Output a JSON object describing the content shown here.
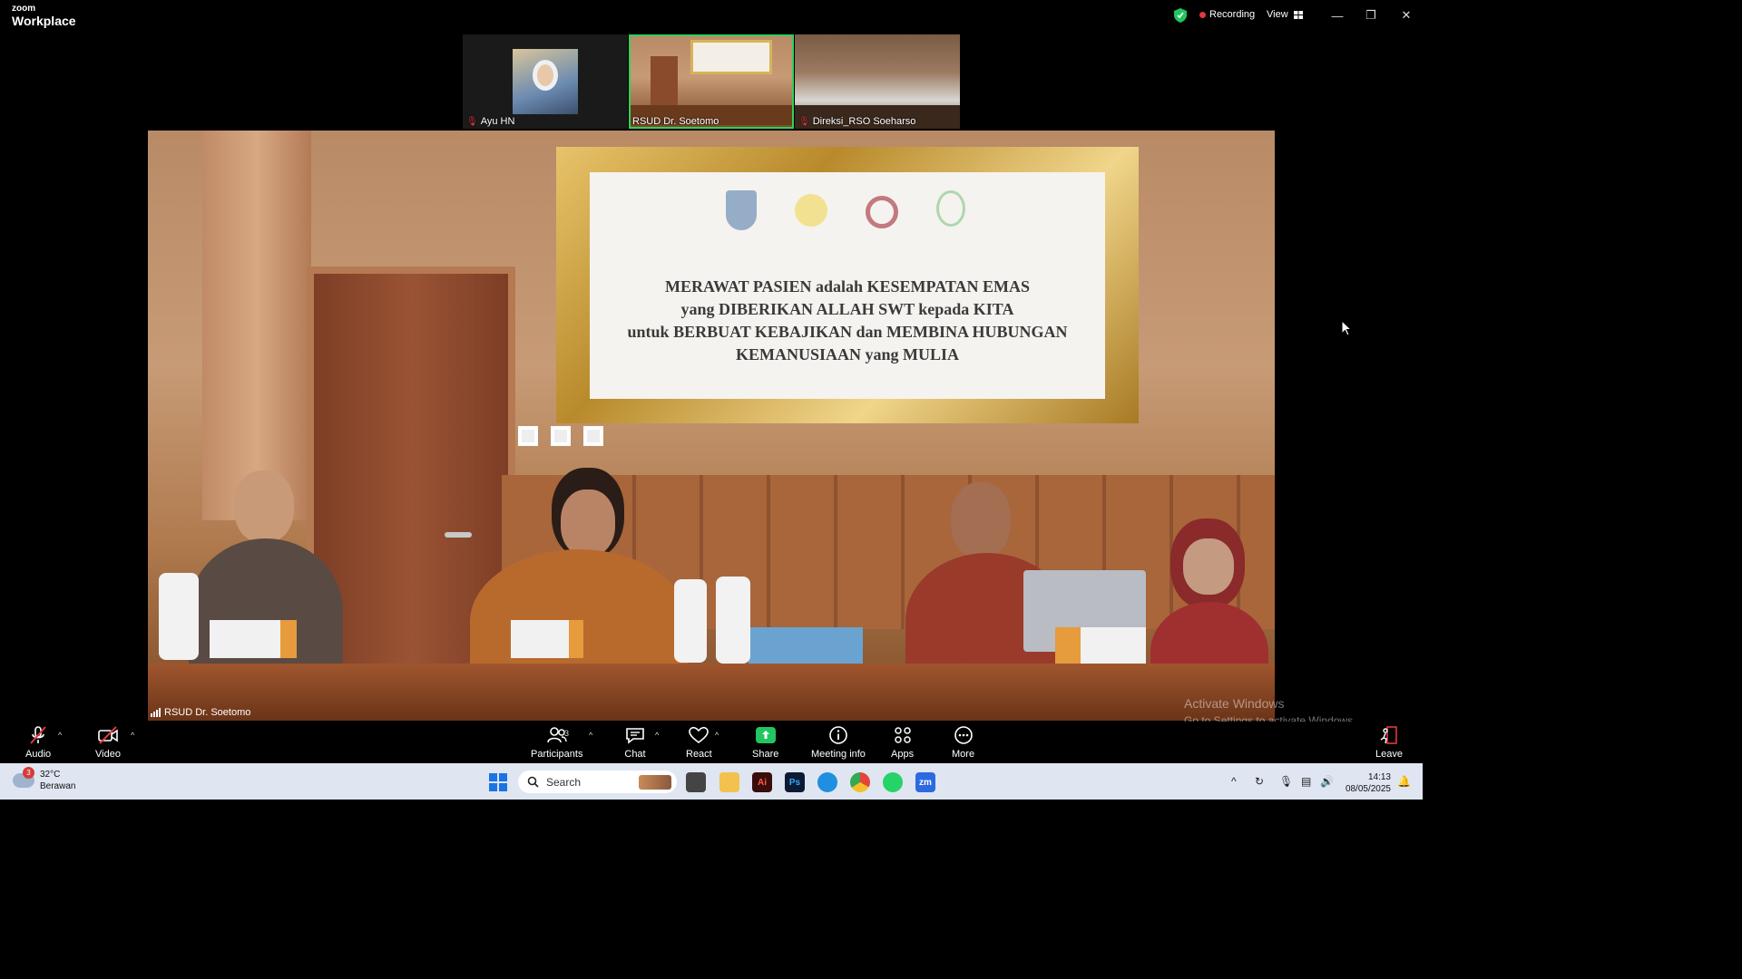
{
  "titlebar": {
    "brand_top": "zoom",
    "brand_bottom": "Workplace",
    "recording_label": "Recording",
    "view_label": "View"
  },
  "participants_strip": [
    {
      "name": "Ayu HN",
      "muted": true
    },
    {
      "name": "RSUD Dr. Soetomo",
      "muted": false,
      "active": true
    },
    {
      "name": "Direksi_RSO Soeharso",
      "muted": true
    }
  ],
  "main_video": {
    "speaker_label": "RSUD Dr. Soetomo",
    "banner_lines": [
      "MERAWAT PASIEN adalah KESEMPATAN EMAS",
      "yang DIBERIKAN ALLAH SWT kepada KITA",
      "untuk BERBUAT KEBAJIKAN dan MEMBINA HUBUNGAN",
      "KEMANUSIAAN yang MULIA"
    ]
  },
  "watermark": {
    "line1": "Activate Windows",
    "line2": "Go to Settings to activate Windows."
  },
  "toolbar": {
    "audio": "Audio",
    "video": "Video",
    "participants": "Participants",
    "participants_count": "3",
    "chat": "Chat",
    "react": "React",
    "share": "Share",
    "meeting_info": "Meeting info",
    "apps": "Apps",
    "more": "More",
    "leave": "Leave"
  },
  "taskbar": {
    "weather_temp": "32°C",
    "weather_desc": "Berawan",
    "weather_badge": "3",
    "search_placeholder": "Search",
    "time": "14:13",
    "date": "08/05/2025"
  },
  "colors": {
    "active_border": "#2fd25b",
    "recording_dot": "#e0393e",
    "share_green": "#22c55e",
    "taskbar_bg": "#dfe6f2"
  }
}
